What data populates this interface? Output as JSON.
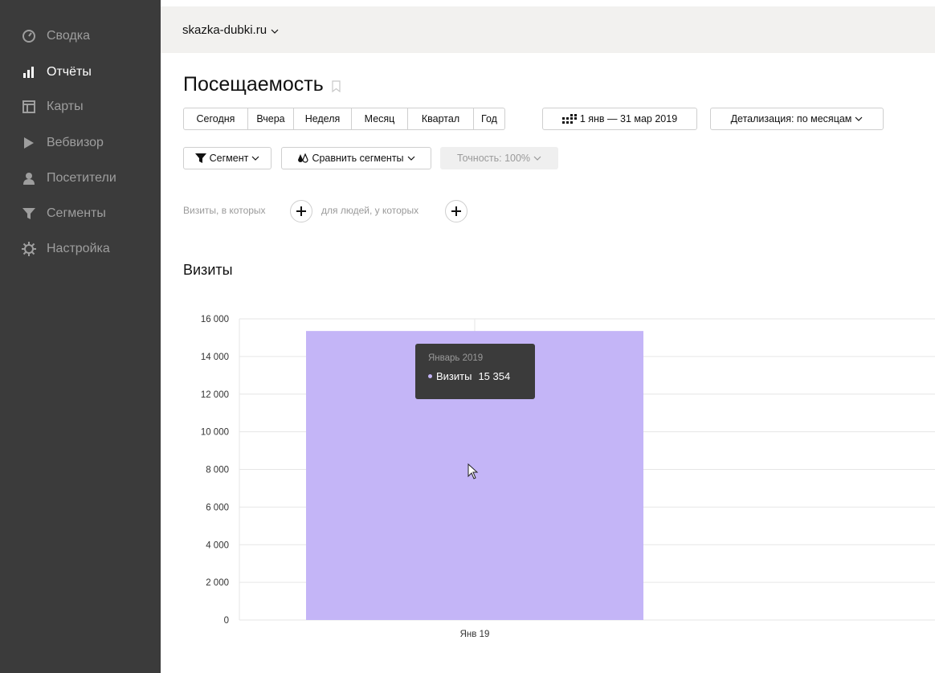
{
  "sidebar": {
    "items": [
      {
        "label": "Сводка",
        "icon": "gauge-icon",
        "active": false
      },
      {
        "label": "Отчёты",
        "icon": "bar-chart-icon",
        "active": true
      },
      {
        "label": "Карты",
        "icon": "map-icon",
        "active": false
      },
      {
        "label": "Вебвизор",
        "icon": "play-icon",
        "active": false
      },
      {
        "label": "Посетители",
        "icon": "person-icon",
        "active": false
      },
      {
        "label": "Сегменты",
        "icon": "filter-icon",
        "active": false
      },
      {
        "label": "Настройка",
        "icon": "gear-icon",
        "active": false
      }
    ]
  },
  "topbar": {
    "site": "skazka-dubki.ru"
  },
  "page": {
    "title": "Посещаемость"
  },
  "periods": [
    "Сегодня",
    "Вчера",
    "Неделя",
    "Месяц",
    "Квартал",
    "Год"
  ],
  "date_range": "1 янв — 31 мар 2019",
  "detail": "Детализация: по месяцам",
  "segment": "Сегмент",
  "compare": "Сравнить сегменты",
  "accuracy": "Точность: 100%",
  "filters": {
    "visits_text": "Визиты, в которых",
    "people_text": "для людей, у которых"
  },
  "section_title": "Визиты",
  "tooltip": {
    "title": "Январь 2019",
    "series": "Визиты",
    "value": "15 354"
  },
  "colors": {
    "sidebar_bg": "#3b3b3b",
    "bar": "#c4b5f7",
    "topbar_bg": "#f2f1ef"
  },
  "chart_data": {
    "type": "bar",
    "categories": [
      "Янв 19"
    ],
    "series": [
      {
        "name": "Визиты",
        "values": [
          15354
        ]
      }
    ],
    "ylim": [
      0,
      16000
    ],
    "yticks": [
      "16 000",
      "14 000",
      "12 000",
      "10 000",
      "8 000",
      "6 000",
      "4 000",
      "2 000",
      "0"
    ],
    "ytick_values": [
      16000,
      14000,
      12000,
      10000,
      8000,
      6000,
      4000,
      2000,
      0
    ],
    "grid": true
  }
}
